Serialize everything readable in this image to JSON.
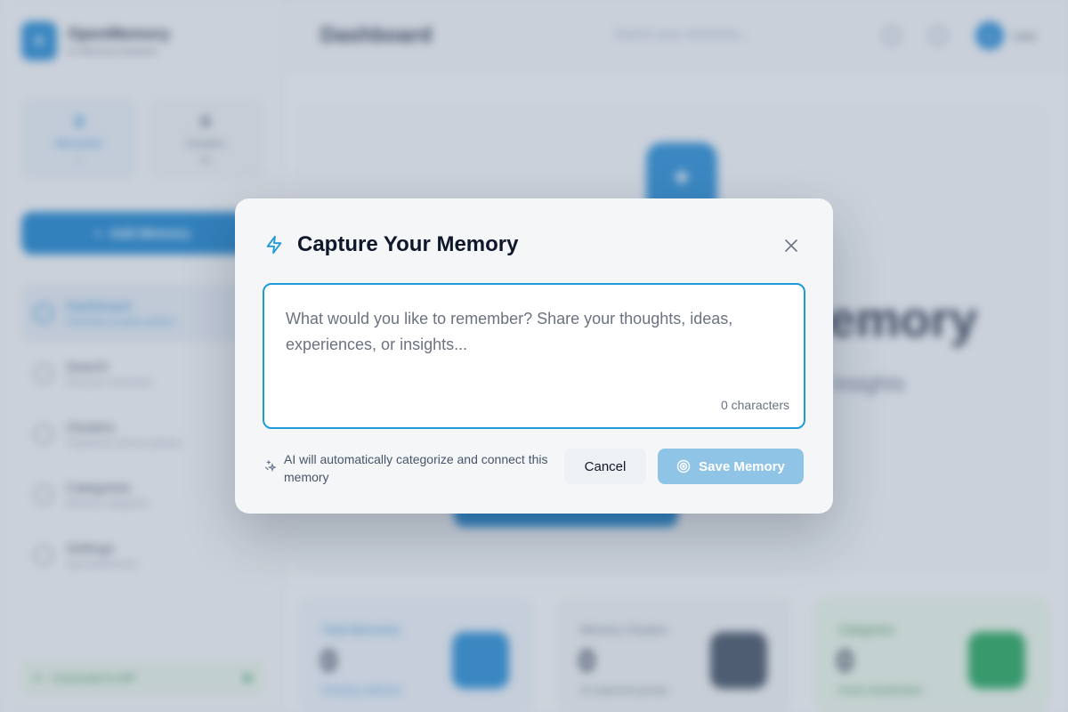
{
  "app": {
    "brand": {
      "name": "OpenMemory",
      "subtitle": "AI Memory Assistant"
    },
    "sidebar_stats": [
      {
        "value": "0",
        "label": "Memories",
        "sub": "+"
      },
      {
        "value": "0",
        "label": "Clusters",
        "sub": "AI"
      }
    ],
    "add_button": "Add Memory",
    "nav": [
      {
        "title": "Dashboard",
        "sub": "Overview & quick actions"
      },
      {
        "title": "Search",
        "sub": "Find your memories"
      },
      {
        "title": "Clusters",
        "sub": "Organized memory groups"
      },
      {
        "title": "Categories",
        "sub": "Memory categories"
      },
      {
        "title": "Settings",
        "sub": "App preferences"
      }
    ],
    "connection": "Connected to IDP",
    "header": {
      "title": "Dashboard",
      "search_placeholder": "Search your memories...",
      "user_initial": "U",
      "user_name": "User"
    },
    "hero": {
      "title": "Welcome to OpenMemory",
      "description": "Capture, organize, search, and discover insights from your experiences with AI"
    },
    "kpis": [
      {
        "label": "Total Memories",
        "value": "0",
        "sub": "Growing collection"
      },
      {
        "label": "Memory Clusters",
        "value": "0",
        "sub": "AI-organized groups"
      },
      {
        "label": "Categories",
        "value": "0",
        "sub": "Smart classification"
      }
    ]
  },
  "modal": {
    "title": "Capture Your Memory",
    "textarea_placeholder": "What would you like to remember? Share your thoughts, ideas, experiences, or insights...",
    "char_count": "0 characters",
    "ai_note": "AI will automatically categorize and connect this memory",
    "cancel_label": "Cancel",
    "save_label": "Save Memory",
    "colors": {
      "accent": "#1f9ad6",
      "save_disabled": "#8fc4e6"
    }
  }
}
